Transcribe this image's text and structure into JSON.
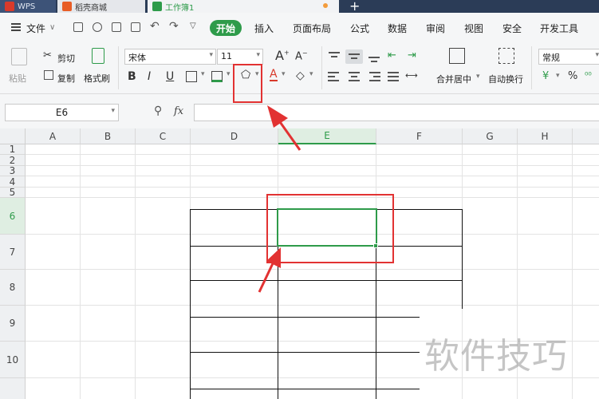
{
  "tabs": {
    "wps": "WPS",
    "mall": "稻壳商城",
    "book": "工作簿1"
  },
  "menu": {
    "file": "文件",
    "start": "开始",
    "items": [
      "插入",
      "页面布局",
      "公式",
      "数据",
      "审阅",
      "视图",
      "安全",
      "开发工具"
    ]
  },
  "ribbon": {
    "paste": "粘贴",
    "cut": "剪切",
    "copy": "复制",
    "format_painter": "格式刷",
    "font_name": "宋体",
    "font_size": "11",
    "merge_center": "合并居中",
    "wrap_text": "自动换行",
    "number_format": "常规"
  },
  "formula_bar": {
    "cell_ref": "E6",
    "fx": "fx"
  },
  "sheet": {
    "columns": [
      "A",
      "B",
      "C",
      "D",
      "E",
      "F",
      "G",
      "H"
    ],
    "rows": [
      "1",
      "2",
      "3",
      "4",
      "5",
      "6",
      "7",
      "8",
      "9",
      "10"
    ],
    "active_column": "E",
    "active_row": "6"
  },
  "watermark": "软件技巧",
  "colors": {
    "accent_green": "#2e9b4a",
    "annotation_red": "#e23232",
    "titlebar": "#2b3c57"
  }
}
